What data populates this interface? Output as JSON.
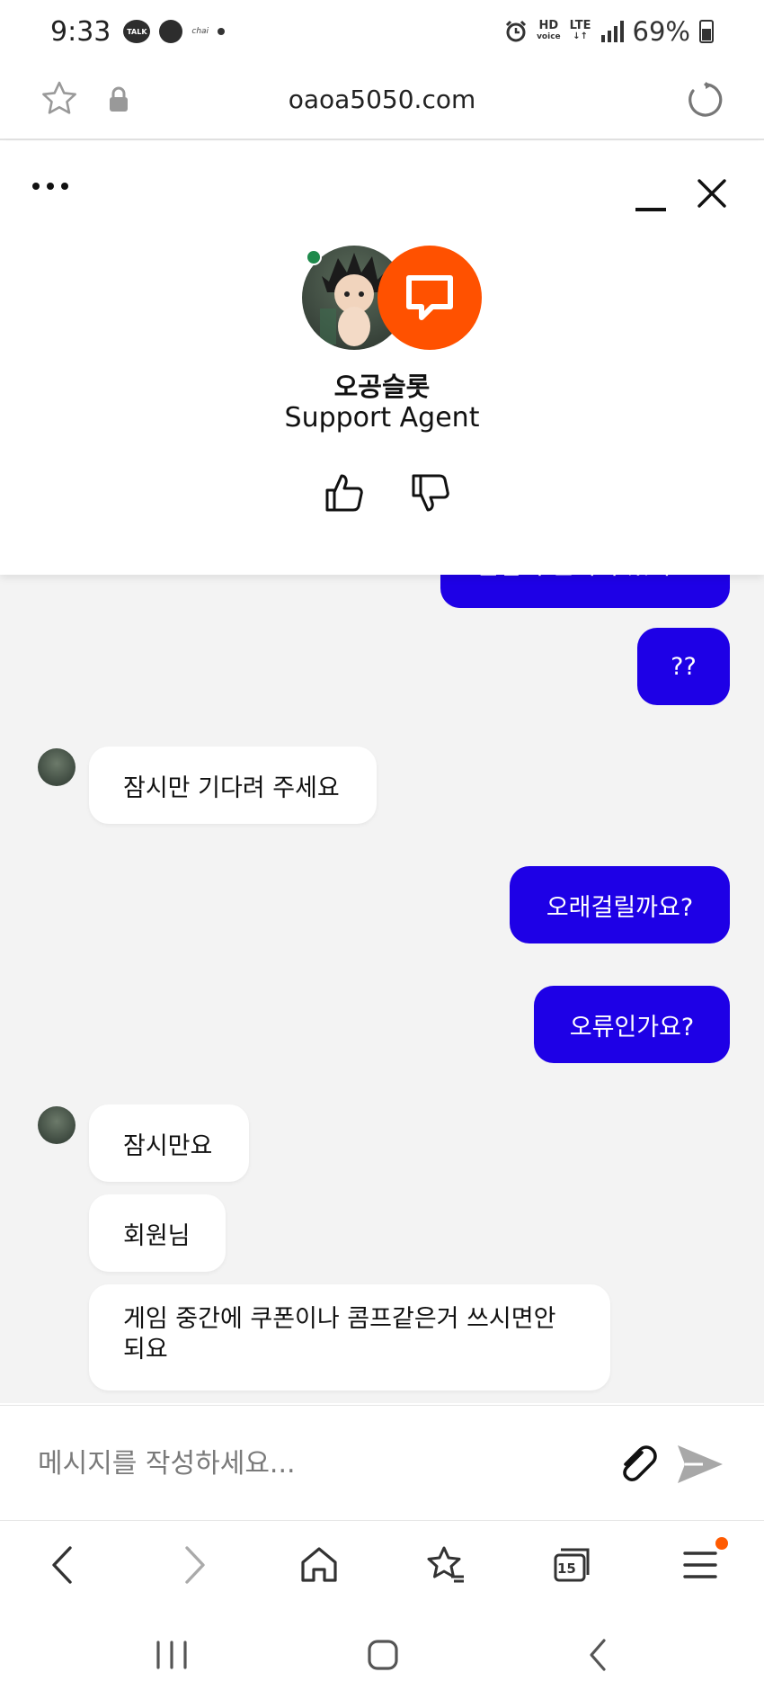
{
  "status_bar": {
    "time": "9:33",
    "talk_badge": "TALK",
    "chai_label": "chai",
    "hd_label": "HD",
    "voice_label": "voice",
    "lte_label": "LTE",
    "battery": "69%"
  },
  "browser": {
    "url": "oaoa5050.com"
  },
  "chat_header": {
    "agent_name": "오공슬롯",
    "agent_role": "Support Agent",
    "agent_online": true,
    "brand_color": "#ff5100"
  },
  "messages": {
    "partial_top": "콜심이 원의이 있어요",
    "out_1": "??",
    "in_1": "잠시만 기다려 주세요",
    "out_2": "오래걸릴까요?",
    "out_3": "오류인가요?",
    "in_2": "잠시만요",
    "in_3": "회원님",
    "in_4_line1": "게임 중간에 쿠폰이나 콤프같은거 쓰시면안",
    "in_4_line2": "되요"
  },
  "composer": {
    "placeholder": "메시지를 작성하세요..."
  },
  "browser_nav": {
    "tabs_count": "15",
    "menu_badge_color": "#ff5a00"
  },
  "colors": {
    "outgoing_bubble": "#1e00e6",
    "chat_background": "#f3f3f3"
  }
}
